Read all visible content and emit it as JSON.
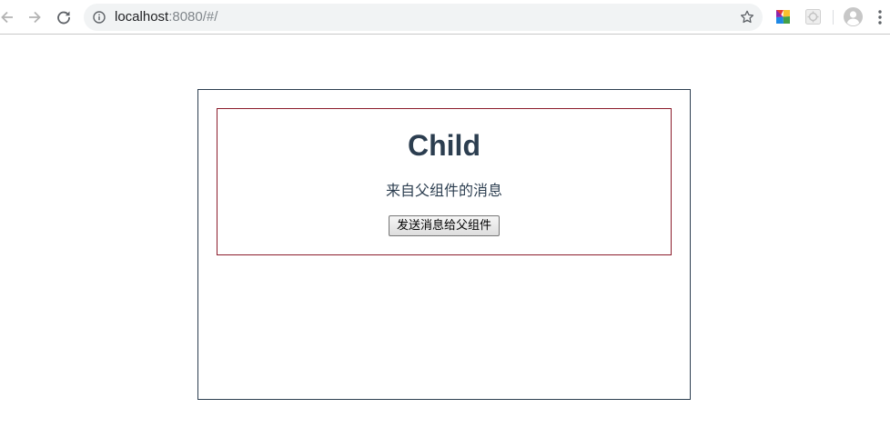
{
  "browser": {
    "url_host": "localhost",
    "url_rest": ":8080/#/",
    "icons": {
      "back": "arrow-left",
      "forward": "arrow-right",
      "reload": "reload",
      "info": "info-circle",
      "bookmark": "star-outline",
      "extension_1": "colorful-pinwheel",
      "extension_2": "gray-extension",
      "profile": "avatar",
      "menu": "vertical-dots"
    }
  },
  "page": {
    "child": {
      "title": "Child",
      "message": "来自父组件的消息",
      "button_label": "发送消息给父组件"
    },
    "colors": {
      "parent_border": "#2c3e50",
      "child_border": "#8b1c2b",
      "text": "#2c3e50"
    }
  }
}
